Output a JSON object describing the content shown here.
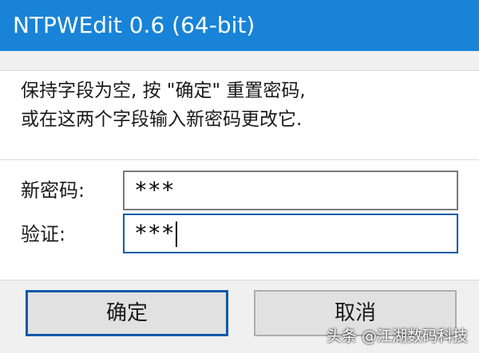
{
  "window": {
    "title": "NTPWEdit 0.6 (64-bit)"
  },
  "instructions": {
    "line1": "保持字段为空, 按 \"确定\" 重置密码,",
    "line2": "或在这两个字段输入新密码更改它."
  },
  "fields": {
    "new_password": {
      "label": "新密码:",
      "value": "***"
    },
    "verify": {
      "label": "验证:",
      "value": "***"
    }
  },
  "buttons": {
    "ok_label": "确定",
    "cancel_label": "取消"
  },
  "watermark": {
    "text": "头条 @江湖数码科技"
  },
  "colors": {
    "titlebar": "#1883d7",
    "focus_border": "#0a5aa8",
    "button_face": "#e1e1e1",
    "dialog_background": "#f0f0f0"
  }
}
